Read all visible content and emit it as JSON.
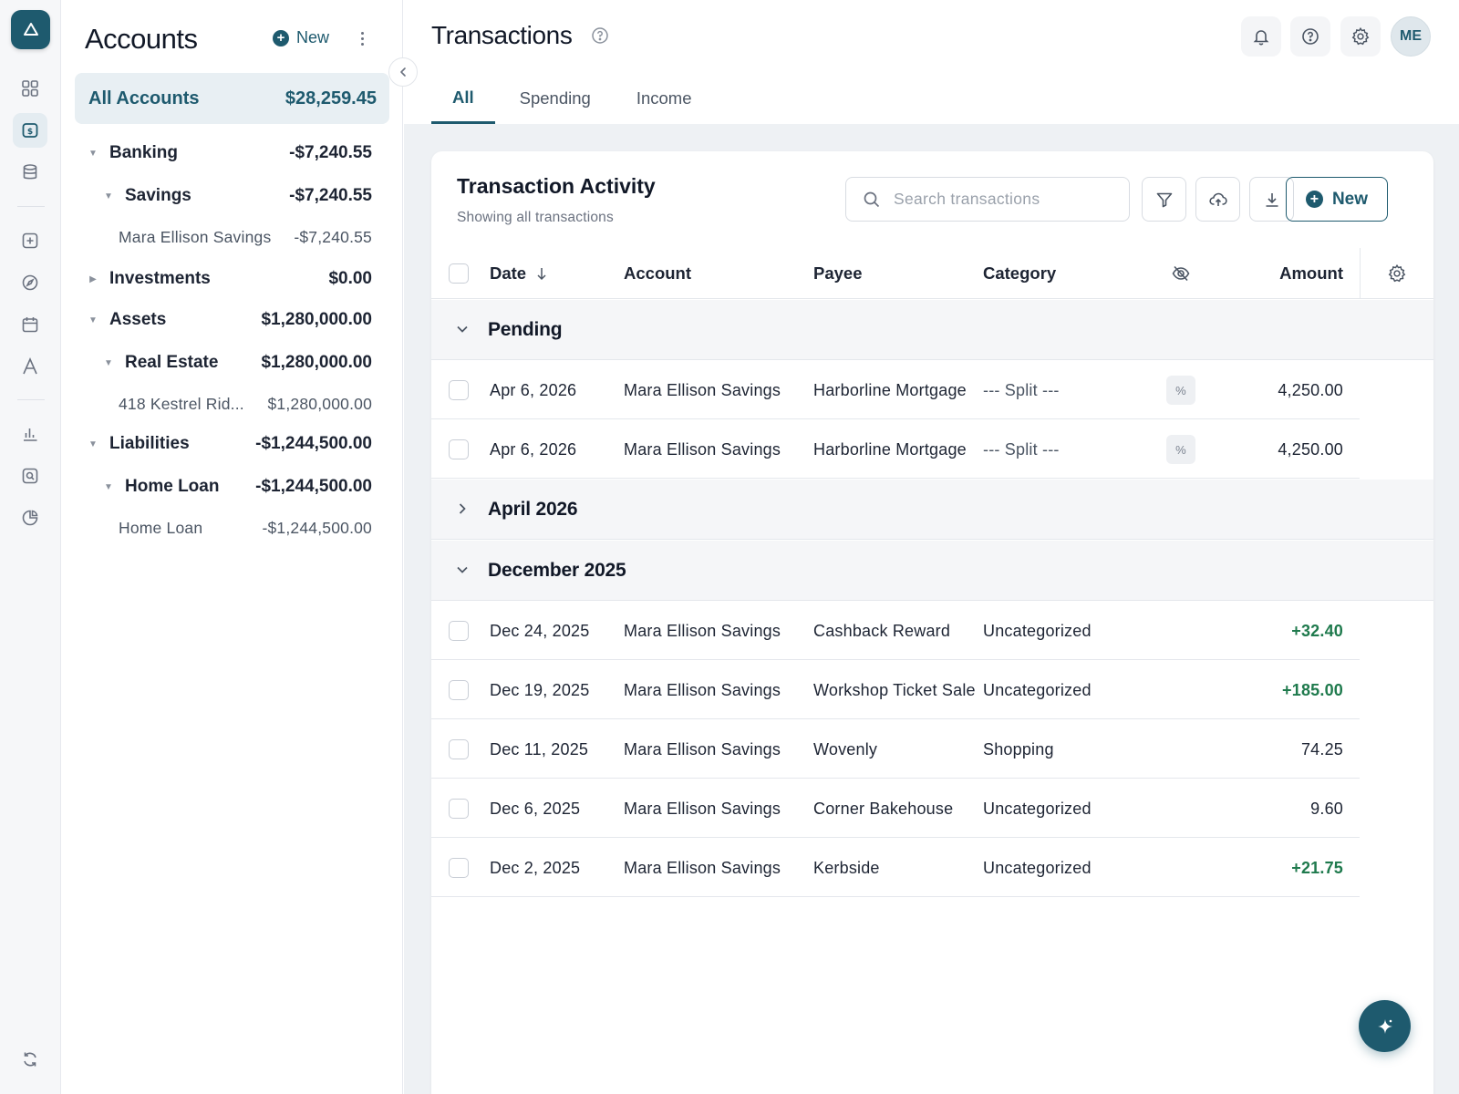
{
  "rail": {
    "icons": [
      "logo-icon",
      "dashboard-icon",
      "accounts-icon",
      "database-icon",
      "add-box-icon",
      "compass-icon",
      "calendar-icon",
      "type-icon",
      "bar-chart-icon",
      "search-box-icon",
      "pie-chart-icon",
      "sync-icon"
    ],
    "active": "accounts-icon"
  },
  "accounts": {
    "title": "Accounts",
    "new_label": "New",
    "all": {
      "label": "All Accounts",
      "amount": "$28,259.45"
    },
    "tree": [
      {
        "label": "Banking",
        "amount": "-$7,240.55",
        "level": 0,
        "expanded": true
      },
      {
        "label": "Savings",
        "amount": "-$7,240.55",
        "level": 1,
        "expanded": true
      },
      {
        "label": "Mara Ellison Savings",
        "amount": "-$7,240.55",
        "level": 2
      },
      {
        "label": "Investments",
        "amount": "$0.00",
        "level": 0,
        "expanded": false
      },
      {
        "label": "Assets",
        "amount": "$1,280,000.00",
        "level": 0,
        "expanded": true
      },
      {
        "label": "Real Estate",
        "amount": "$1,280,000.00",
        "level": 1,
        "expanded": true
      },
      {
        "label": "418 Kestrel Rid...",
        "amount": "$1,280,000.00",
        "level": 2
      },
      {
        "label": "Liabilities",
        "amount": "-$1,244,500.00",
        "level": 0,
        "expanded": true
      },
      {
        "label": "Home Loan",
        "amount": "-$1,244,500.00",
        "level": 1,
        "expanded": true
      },
      {
        "label": "Home Loan",
        "amount": "-$1,244,500.00",
        "level": 2
      }
    ]
  },
  "header": {
    "title": "Transactions",
    "avatar_initials": "ME",
    "tabs": [
      {
        "label": "All",
        "active": true
      },
      {
        "label": "Spending",
        "active": false
      },
      {
        "label": "Income",
        "active": false
      }
    ]
  },
  "card": {
    "title": "Transaction Activity",
    "subtitle": "Showing all transactions",
    "search_placeholder": "Search transactions",
    "new_label": "New",
    "columns": {
      "date": "Date",
      "account": "Account",
      "payee": "Payee",
      "category": "Category",
      "amount": "Amount"
    },
    "groups": [
      {
        "label": "Pending",
        "expanded": true,
        "rows": [
          {
            "date": "Apr 6, 2026",
            "account": "Mara Ellison Savings",
            "payee": "Harborline Mortgage",
            "category": "--- Split ---",
            "split_badge": "%",
            "amount": "4,250.00",
            "positive": false
          },
          {
            "date": "Apr 6, 2026",
            "account": "Mara Ellison Savings",
            "payee": "Harborline Mortgage",
            "category": "--- Split ---",
            "split_badge": "%",
            "amount": "4,250.00",
            "positive": false
          }
        ]
      },
      {
        "label": "April 2026",
        "expanded": false,
        "rows": []
      },
      {
        "label": "December 2025",
        "expanded": true,
        "rows": [
          {
            "date": "Dec 24, 2025",
            "account": "Mara Ellison Savings",
            "payee": "Cashback Reward",
            "category": "Uncategorized",
            "amount": "+32.40",
            "positive": true
          },
          {
            "date": "Dec 19, 2025",
            "account": "Mara Ellison Savings",
            "payee": "Workshop Ticket Sale",
            "category": "Uncategorized",
            "amount": "+185.00",
            "positive": true
          },
          {
            "date": "Dec 11, 2025",
            "account": "Mara Ellison Savings",
            "payee": "Wovenly",
            "category": "Shopping",
            "amount": "74.25",
            "positive": false
          },
          {
            "date": "Dec 6, 2025",
            "account": "Mara Ellison Savings",
            "payee": "Corner Bakehouse",
            "category": "Uncategorized",
            "amount": "9.60",
            "positive": false
          },
          {
            "date": "Dec 2, 2025",
            "account": "Mara Ellison Savings",
            "payee": "Kerbside",
            "category": "Uncategorized",
            "amount": "+21.75",
            "positive": true
          }
        ]
      }
    ]
  },
  "colors": {
    "accent": "#1e5a6e",
    "positive": "#1f7a4d",
    "surface": "#eef1f4"
  }
}
